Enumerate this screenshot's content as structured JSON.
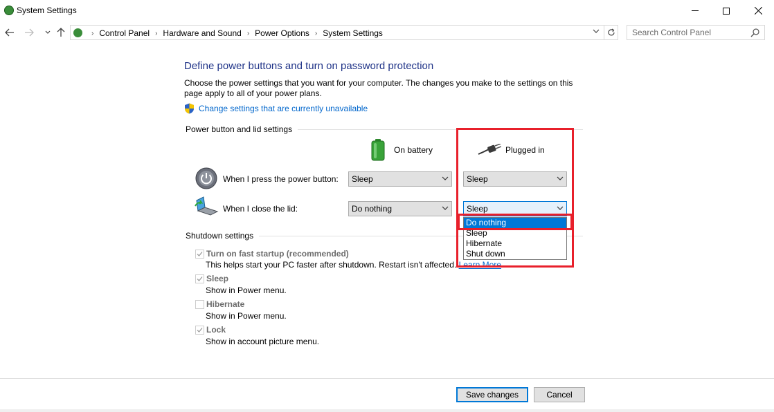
{
  "window": {
    "title": "System Settings",
    "icon": "control-panel-icon"
  },
  "navigation": {
    "breadcrumbs": [
      "Control Panel",
      "Hardware and Sound",
      "Power Options",
      "System Settings"
    ],
    "search_placeholder": "Search Control Panel"
  },
  "main": {
    "title": "Define power buttons and turn on password protection",
    "description": "Choose the power settings that you want for your computer. The changes you make to the settings on this page apply to all of your power plans.",
    "change_link": "Change settings that are currently unavailable",
    "power_section": {
      "label": "Power button and lid settings",
      "col_battery": "On battery",
      "col_plugged": "Plugged in",
      "rows": [
        {
          "label": "When I press the power button:",
          "battery": "Sleep",
          "plugged": "Sleep"
        },
        {
          "label": "When I close the lid:",
          "battery": "Do nothing",
          "plugged": "Sleep"
        }
      ],
      "open_dropdown": {
        "options": [
          "Do nothing",
          "Sleep",
          "Hibernate",
          "Shut down"
        ],
        "highlighted": "Do nothing"
      }
    },
    "shutdown_section": {
      "label": "Shutdown settings",
      "items": [
        {
          "label": "Turn on fast startup (recommended)",
          "checked": true,
          "description": "This helps start your PC faster after shutdown. Restart isn't affected.",
          "link": "Learn More"
        },
        {
          "label": "Sleep",
          "checked": true,
          "description": "Show in Power menu."
        },
        {
          "label": "Hibernate",
          "checked": false,
          "description": "Show in Power menu."
        },
        {
          "label": "Lock",
          "checked": true,
          "description": "Show in account picture menu."
        }
      ]
    }
  },
  "footer": {
    "save_label": "Save changes",
    "cancel_label": "Cancel"
  },
  "colors": {
    "title_blue": "#1e3287",
    "link_blue": "#0066cc",
    "selection_blue": "#0078d7",
    "annotation_red": "#e8202b"
  }
}
